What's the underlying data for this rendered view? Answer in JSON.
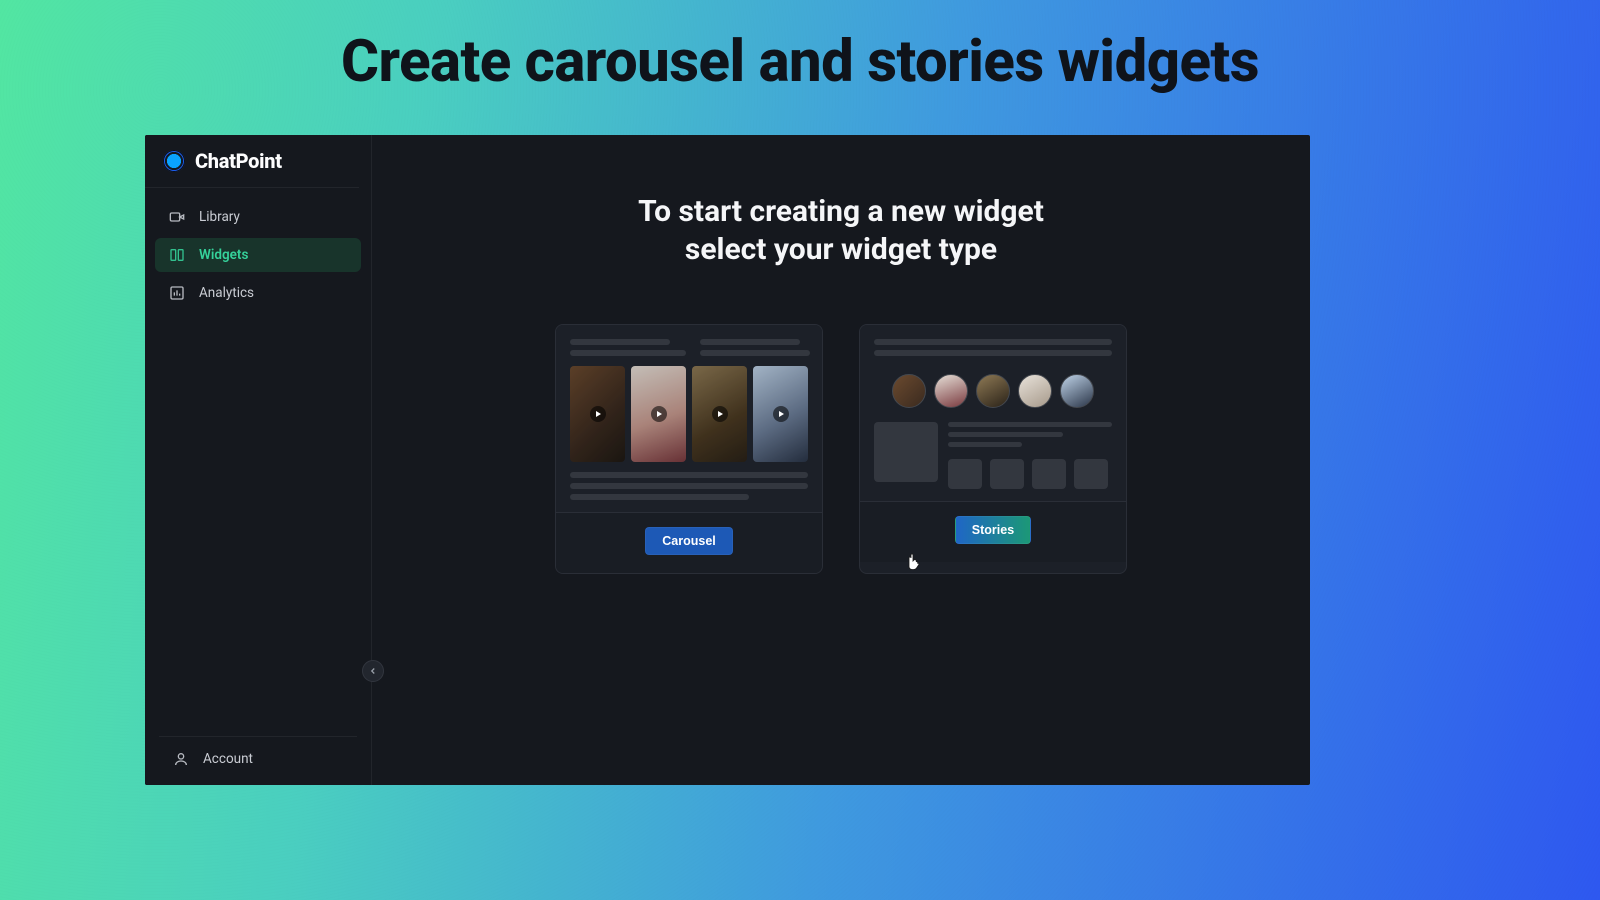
{
  "frame": {
    "title": "Create carousel and stories widgets"
  },
  "brand": {
    "name": "ChatPoint"
  },
  "sidebar": {
    "items": [
      {
        "label": "Library",
        "icon": "video-icon"
      },
      {
        "label": "Widgets",
        "icon": "widgets-icon"
      },
      {
        "label": "Analytics",
        "icon": "chart-icon"
      }
    ],
    "account_label": "Account"
  },
  "page": {
    "heading": "To start creating a new widget\nselect your widget type"
  },
  "cards": [
    {
      "type": "carousel",
      "button_label": "Carousel"
    },
    {
      "type": "stories",
      "button_label": "Stories"
    }
  ],
  "colors": {
    "accent_green": "#35d19a",
    "button_blue": "#1d59b6",
    "panel": "#1c2028",
    "app_bg": "#15181e"
  }
}
